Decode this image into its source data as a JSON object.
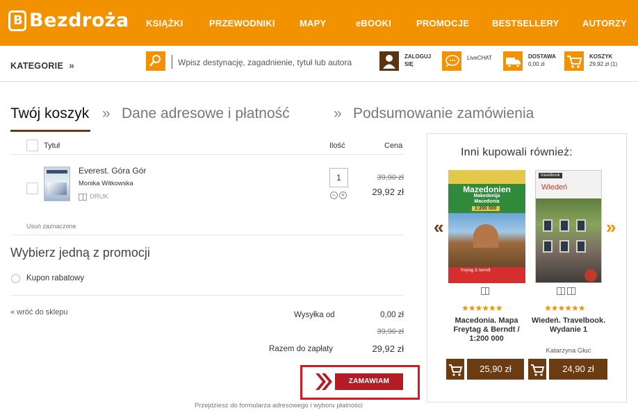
{
  "header": {
    "logo_text": "Bezdroża",
    "nav": [
      "KSIĄŻKI",
      "PRZEWODNIKI",
      "MAPY",
      "eBOOKI",
      "PROMOCJE",
      "BESTSELLERY",
      "AUTORZY"
    ],
    "brand_color": "#f39200"
  },
  "subbar": {
    "categories_label": "KATEGORIE",
    "search_placeholder": "Wpisz destynację, zagadnienie, tytuł lub autora",
    "login_line1": "ZALOGUJ",
    "login_line2": "SIĘ",
    "livechat": "LiveCHAT",
    "delivery_label": "DOSTAWA",
    "delivery_value": "0,00 zł",
    "cart_label": "KOSZYK",
    "cart_value": "29,92 zł (1)"
  },
  "steps": {
    "active": "Twój koszyk",
    "sep": "»",
    "step2": "Dane adresowe i płatność",
    "step3": "Podsumowanie zamówienia"
  },
  "cart": {
    "col_title": "Tytuł",
    "col_qty": "Ilość",
    "col_price": "Cena",
    "items": [
      {
        "title": "Everest. Góra Gór",
        "author": "Monika Witkowska",
        "format": "DRUK",
        "qty": "1",
        "price_old": "39,90 zł",
        "price_new": "29,92 zł"
      }
    ],
    "remove_selected": "Usuń zaznaczone"
  },
  "promo": {
    "title": "Wybierz jedną z promocji",
    "option": "Kupon rabatowy"
  },
  "summary": {
    "back_link": "«  wróć do sklepu",
    "shipping_label": "Wysyłka od",
    "shipping_value": "0,00 zł",
    "old_total": "39,90 zł",
    "total_label": "Razem do zapłaty",
    "total_value": "29,92 zł",
    "order_button": "ZAMAWIAM",
    "order_note": "Przejdziesz do formularza adresowego i wyboru płatności"
  },
  "also_bought": {
    "title": "Inni kupowali również:",
    "products": [
      {
        "name": "Macedonia. Mapa Freytag & Berndt / 1:200 000",
        "author": "",
        "price": "25,90 zł",
        "rating": 5,
        "cover_title": "Mazedonien",
        "cover_sub1": "Makedonija",
        "cover_sub2": "Macedonia",
        "cover_scale": "1:200 000",
        "cover_publisher": "freytag & berndt"
      },
      {
        "name": "Wiedeń. Travelbook. Wydanie 1",
        "author": "Katarzyna Głuc",
        "price": "24,90 zł",
        "rating": 5,
        "cover_title": "Wiedeń",
        "cover_brand": "travelbook"
      }
    ]
  },
  "colors": {
    "accent": "#f39200",
    "brown": "#6b3b12",
    "order_red": "#b21d25",
    "highlight_frame": "#d5181f"
  }
}
